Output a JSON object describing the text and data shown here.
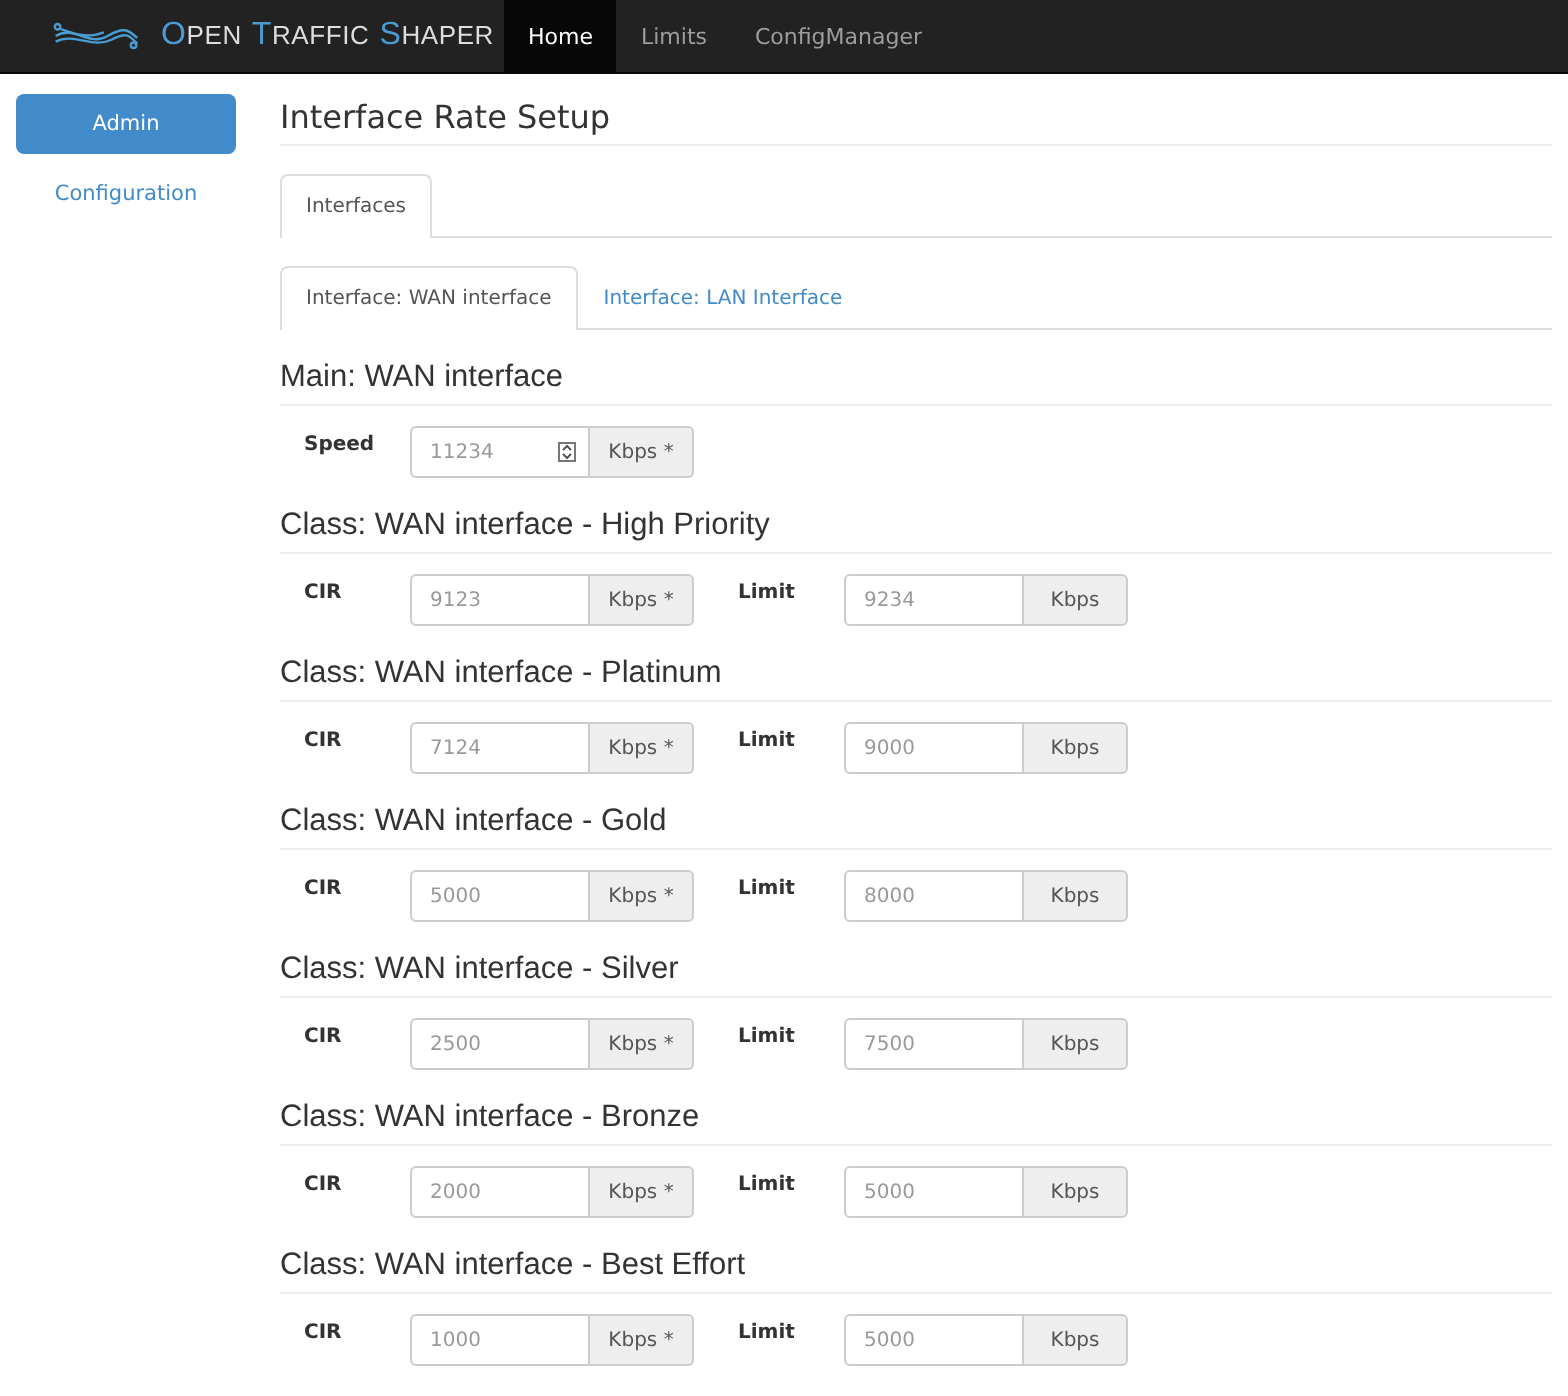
{
  "navbar": {
    "brand_words": [
      "OPEN",
      "TRAFFIC",
      "SHAPER"
    ],
    "items": [
      {
        "label": "Home",
        "selected": true
      },
      {
        "label": "Limits",
        "selected": false
      },
      {
        "label": "ConfigManager",
        "selected": false
      }
    ]
  },
  "sidebar": {
    "items": [
      {
        "label": "Admin",
        "selected": true
      },
      {
        "label": "Configuration",
        "selected": false
      }
    ]
  },
  "page_title": "Interface Rate Setup",
  "tabs": [
    {
      "label": "Interfaces",
      "selected": true
    }
  ],
  "subtabs": [
    {
      "label": "Interface: WAN interface",
      "selected": true
    },
    {
      "label": "Interface: LAN Interface",
      "selected": false
    }
  ],
  "sections": [
    {
      "heading": "Main: WAN interface",
      "fields": [
        {
          "label": "Speed",
          "value": "11234",
          "unit": "Kbps *",
          "spinner": true
        }
      ]
    },
    {
      "heading": "Class: WAN interface - High Priority",
      "fields": [
        {
          "label": "CIR",
          "value": "9123",
          "unit": "Kbps *",
          "spinner": false
        },
        {
          "label": "Limit",
          "value": "9234",
          "unit": "Kbps",
          "spinner": false
        }
      ]
    },
    {
      "heading": "Class: WAN interface - Platinum",
      "fields": [
        {
          "label": "CIR",
          "value": "7124",
          "unit": "Kbps *",
          "spinner": false
        },
        {
          "label": "Limit",
          "value": "9000",
          "unit": "Kbps",
          "spinner": false
        }
      ]
    },
    {
      "heading": "Class: WAN interface - Gold",
      "fields": [
        {
          "label": "CIR",
          "value": "5000",
          "unit": "Kbps *",
          "spinner": false
        },
        {
          "label": "Limit",
          "value": "8000",
          "unit": "Kbps",
          "spinner": false
        }
      ]
    },
    {
      "heading": "Class: WAN interface - Silver",
      "fields": [
        {
          "label": "CIR",
          "value": "2500",
          "unit": "Kbps *",
          "spinner": false
        },
        {
          "label": "Limit",
          "value": "7500",
          "unit": "Kbps",
          "spinner": false
        }
      ]
    },
    {
      "heading": "Class: WAN interface - Bronze",
      "fields": [
        {
          "label": "CIR",
          "value": "2000",
          "unit": "Kbps *",
          "spinner": false
        },
        {
          "label": "Limit",
          "value": "5000",
          "unit": "Kbps",
          "spinner": false
        }
      ]
    },
    {
      "heading": "Class: WAN interface - Best Effort",
      "fields": [
        {
          "label": "CIR",
          "value": "1000",
          "unit": "Kbps *",
          "spinner": false
        },
        {
          "label": "Limit",
          "value": "5000",
          "unit": "Kbps",
          "spinner": false
        }
      ]
    }
  ]
}
